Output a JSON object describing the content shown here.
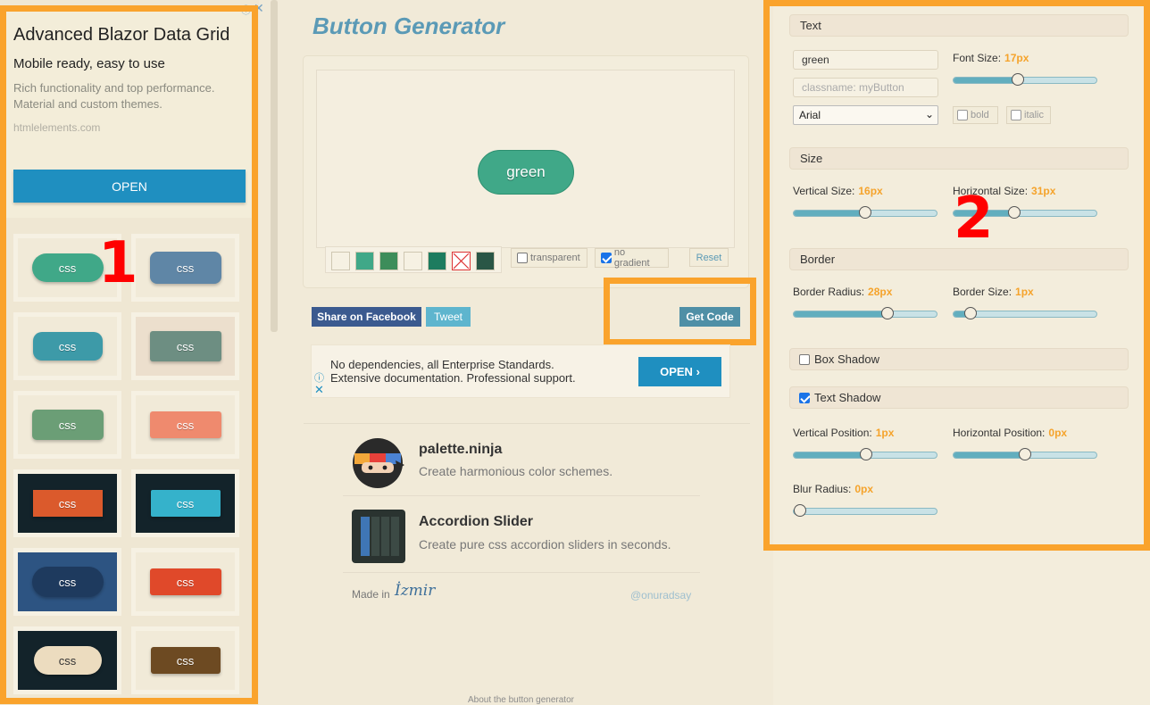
{
  "ad": {
    "title": "Advanced Blazor Data Grid",
    "subtitle": "Mobile ready, easy to use",
    "description": "Rich functionality and top performance. Material and custom themes.",
    "url": "htmlelements.com",
    "open_label": "OPEN"
  },
  "gallery": {
    "button_label": "css",
    "tiles": [
      {
        "bg": "#f1ead8",
        "btn": "#40a888"
      },
      {
        "bg": "#f1ead8",
        "btn": "#5f86a6"
      },
      {
        "bg": "#f1ead8",
        "btn": "#3d9aa8"
      },
      {
        "bg": "#ecdfcd",
        "btn": "#6d8e82"
      },
      {
        "bg": "#f1ead8",
        "btn": "#6b9e76"
      },
      {
        "bg": "#f1ead8",
        "btn": "#ef8a6e"
      },
      {
        "bg": "#13232a",
        "btn": "#db5a2c"
      },
      {
        "bg": "#13232a",
        "btn": "#35b2cb"
      },
      {
        "bg": "#2d5482",
        "btn": "#1e3a5e"
      },
      {
        "bg": "#f1ead8",
        "btn": "#e0492a"
      },
      {
        "bg": "#13232a",
        "btn": "#ecdcbf"
      },
      {
        "bg": "#f1ead8",
        "btn": "#6d4a22"
      }
    ]
  },
  "annotations": {
    "one": "1",
    "two": "2"
  },
  "center": {
    "title": "Button Generator",
    "preview_label": "green",
    "swatches": [
      "#f6f1e3",
      "#40a888",
      "#3d8d5a",
      "#f6f1e3",
      "#1d7c5f",
      "none",
      "#2a5646"
    ],
    "transparent_label": "transparent",
    "no_gradient_label": "no gradient",
    "reset_label": "Reset",
    "share_facebook": "Share on Facebook",
    "tweet": "Tweet",
    "get_code": "Get Code"
  },
  "ad2": {
    "line1": "No dependencies, all Enterprise Standards.",
    "line2": "Extensive documentation. Professional support.",
    "open_label": "OPEN"
  },
  "promos": [
    {
      "title": "palette.ninja",
      "desc": "Create harmonious color schemes."
    },
    {
      "title": "Accordion Slider",
      "desc": "Create pure css accordion sliders in seconds."
    }
  ],
  "footer": {
    "made_in": "Made in",
    "city": "İzmir",
    "handle": "@onuradsay",
    "about": "About the button generator"
  },
  "settings": {
    "text": {
      "header": "Text",
      "text_value": "green",
      "classname_placeholder": "classname: myButton",
      "font_value": "Arial",
      "font_size_label": "Font Size:",
      "font_size_value": "17px",
      "font_size_level": 0.44,
      "bold_label": "bold",
      "italic_label": "italic"
    },
    "size": {
      "header": "Size",
      "vertical_label": "Vertical Size:",
      "vertical_value": "16px",
      "vertical_level": 0.49,
      "horizontal_label": "Horizontal Size:",
      "horizontal_value": "31px",
      "horizontal_level": 0.41
    },
    "border": {
      "header": "Border",
      "radius_label": "Border Radius:",
      "radius_value": "28px",
      "radius_level": 0.66,
      "size_label": "Border Size:",
      "size_value": "1px",
      "size_level": 0.08
    },
    "box_shadow": {
      "header": "Box Shadow"
    },
    "text_shadow": {
      "header": "Text Shadow",
      "vertical_label": "Vertical Position:",
      "vertical_value": "1px",
      "vertical_level": 0.5,
      "horizontal_label": "Horizontal Position:",
      "horizontal_value": "0px",
      "horizontal_level": 0.49,
      "blur_label": "Blur Radius:",
      "blur_value": "0px",
      "blur_level": 0.0
    }
  }
}
